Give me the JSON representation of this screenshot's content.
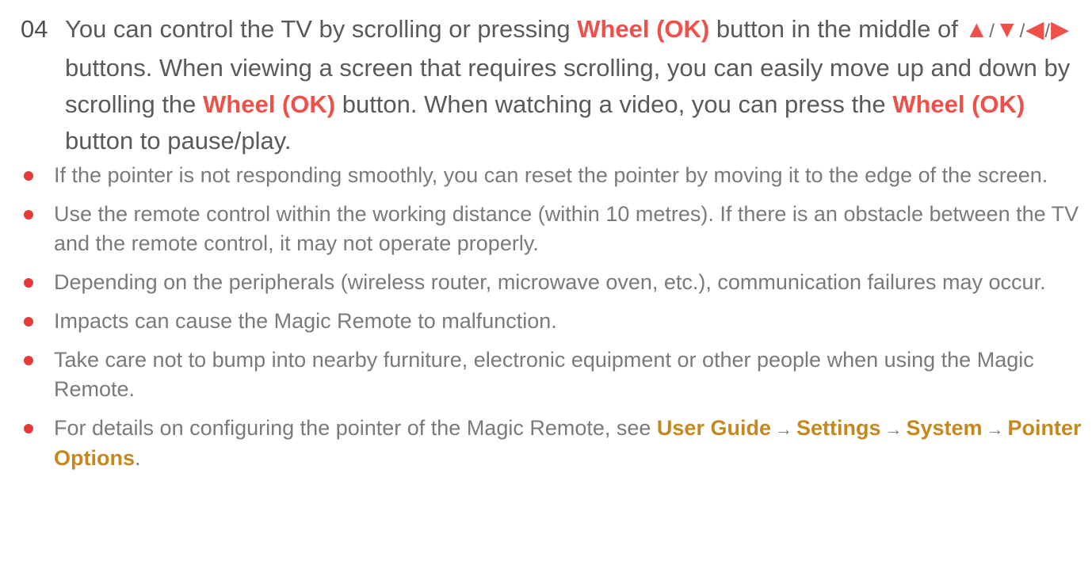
{
  "step": {
    "number": "04",
    "text_1": "You can control the TV by scrolling or pressing ",
    "wheel_1": "Wheel (OK)",
    "text_2": " button in the middle of ",
    "arrows": {
      "up": "▲",
      "down": "▼",
      "left": "◀",
      "right": "▶",
      "separator": "/"
    },
    "text_3": " buttons. When viewing a screen that requires scrolling, you can easily move up and down by scrolling the ",
    "wheel_2": "Wheel (OK)",
    "text_4": " button. When watching a video, you can press the ",
    "wheel_3": "Wheel (OK)",
    "text_5": " button to pause/play."
  },
  "notes": [
    "If the pointer is not responding smoothly, you can reset the pointer by moving it to the edge of the screen.",
    "Use the remote control within the working distance (within 10 metres). If there is an obstacle between the TV and the remote control, it may not operate properly.",
    "Depending on the peripherals (wireless router, microwave oven, etc.), communication failures may occur.",
    "Impacts can cause the Magic Remote to malfunction.",
    "Take care not to bump into nearby furniture, electronic equipment or other people when using the Magic Remote."
  ],
  "last_note": {
    "prefix": "For details on configuring the pointer of the Magic Remote, see ",
    "path": [
      "User Guide",
      "Settings",
      "System",
      "Pointer Options"
    ],
    "arrow": "→",
    "suffix": "."
  },
  "colors": {
    "highlight_red": "#f0504a",
    "highlight_gold": "#c4881e",
    "bullet": "#e63a3a",
    "body_text": "#6e6e6e"
  }
}
